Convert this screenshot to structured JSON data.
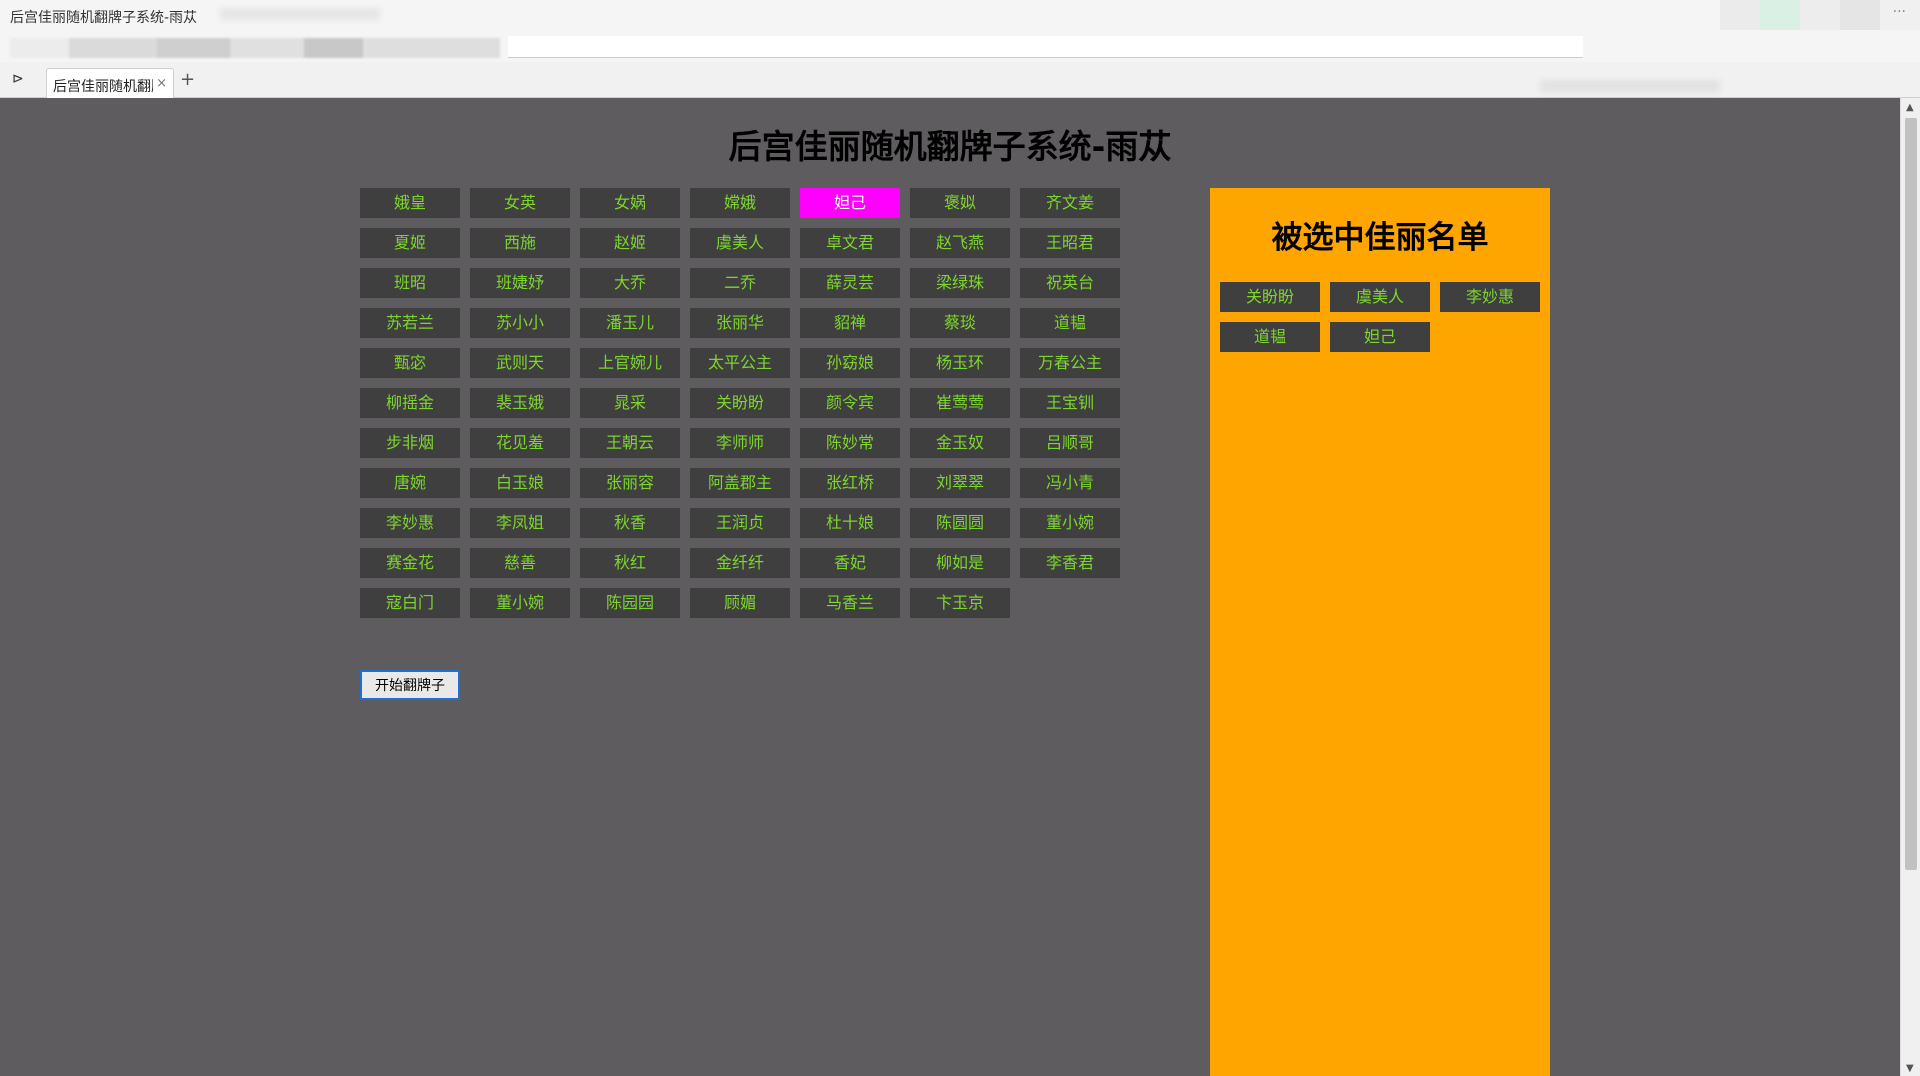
{
  "browser": {
    "window_title": "后宫佳丽随机翻牌子系统-雨苁",
    "tab_label": "后宫佳丽随机翻牌子系统-雨苁",
    "tab_close": "×",
    "new_tab": "+",
    "sidebar_toggle": "⊳",
    "window_menu": "···"
  },
  "page": {
    "title": "后宫佳丽随机翻牌子系统-雨苁",
    "start_button": "开始翻牌子",
    "highlighted": "妲己"
  },
  "grid": {
    "rows": [
      [
        "娥皇",
        "女英",
        "女娲",
        "嫦娥",
        "妲己",
        "褒姒",
        "齐文姜"
      ],
      [
        "夏姬",
        "西施",
        "赵姬",
        "虞美人",
        "卓文君",
        "赵飞燕",
        "王昭君"
      ],
      [
        "班昭",
        "班婕妤",
        "大乔",
        "二乔",
        "薛灵芸",
        "梁绿珠",
        "祝英台"
      ],
      [
        "苏若兰",
        "苏小小",
        "潘玉儿",
        "张丽华",
        "貂禅",
        "蔡琰",
        "道韫"
      ],
      [
        "甄宓",
        "武则天",
        "上官婉儿",
        "太平公主",
        "孙窈娘",
        "杨玉环",
        "万春公主"
      ],
      [
        "柳摇金",
        "裴玉娥",
        "晁采",
        "关盼盼",
        "颜令宾",
        "崔莺莺",
        "王宝钏"
      ],
      [
        "步非烟",
        "花见羞",
        "王朝云",
        "李师师",
        "陈妙常",
        "金玉奴",
        "吕顺哥"
      ],
      [
        "唐婉",
        "白玉娘",
        "张丽容",
        "阿盖郡主",
        "张红桥",
        "刘翠翠",
        "冯小青"
      ],
      [
        "李妙惠",
        "李凤姐",
        "秋香",
        "王润贞",
        "杜十娘",
        "陈圆圆",
        "董小婉"
      ],
      [
        "赛金花",
        "慈善",
        "秋红",
        "金纤纤",
        "香妃",
        "柳如是",
        "李香君"
      ],
      [
        "寇白门",
        "董小婉",
        "陈园园",
        "顾媚",
        "马香兰",
        "卞玉京"
      ]
    ]
  },
  "panel": {
    "title": "被选中佳丽名单",
    "selected": [
      "关盼盼",
      "虞美人",
      "李妙惠",
      "道韫",
      "妲己"
    ]
  },
  "colors": {
    "page_bg": "#5f5c5f",
    "tile_bg": "#3f3f3f",
    "tile_text": "#7dd62e",
    "highlight_bg": "#ff00ff",
    "panel_bg": "#ffa500"
  }
}
